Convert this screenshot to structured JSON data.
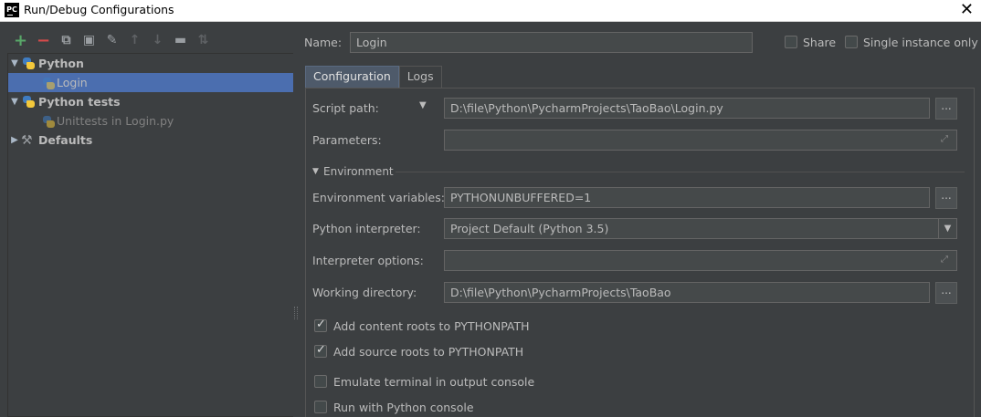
{
  "window": {
    "title": "Run/Debug Configurations",
    "app_icon_text": "PC",
    "close_glyph": "✕"
  },
  "toolbar": {
    "add": "+",
    "remove": "−",
    "copy": "⧉",
    "save": "▣",
    "edit": "✎",
    "move_up": "↑",
    "move_down": "↓",
    "folder": "▬",
    "sort": "⇅"
  },
  "tree": {
    "items": [
      {
        "label": "Python",
        "expanded": true,
        "glyph": "▼"
      },
      {
        "label": "Login",
        "selected": true
      },
      {
        "label": "Python tests",
        "expanded": true,
        "glyph": "▼"
      },
      {
        "label": "Unittests in Login.py"
      },
      {
        "label": "Defaults",
        "expanded": false,
        "glyph": "▶"
      }
    ]
  },
  "name_row": {
    "label": "Name:",
    "value": "Login",
    "share_label": "Share",
    "share_checked": false,
    "single_instance_label": "Single instance only",
    "single_instance_checked": false
  },
  "tabs": [
    {
      "label": "Configuration",
      "active": true
    },
    {
      "label": "Logs",
      "active": false
    }
  ],
  "config": {
    "script_path_label": "Script path:",
    "script_path_dropdown": "▼",
    "script_path_value": "D:\\file\\Python\\PycharmProjects\\TaoBao\\Login.py",
    "parameters_label": "Parameters:",
    "parameters_value": "",
    "environment_section": "Environment",
    "environment_glyph": "▼",
    "env_vars_label": "Environment variables:",
    "env_vars_value": "PYTHONUNBUFFERED=1",
    "interpreter_label": "Python interpreter:",
    "interpreter_value": "Project Default (Python 3.5)",
    "interpreter_options_label": "Interpreter options:",
    "interpreter_options_value": "",
    "working_dir_label": "Working directory:",
    "working_dir_value": "D:\\file\\Python\\PycharmProjects\\TaoBao",
    "browse_glyph": "...",
    "expand_glyph": "⤢",
    "dropdown_glyph": "▼",
    "checkboxes": [
      {
        "label": "Add content roots to PYTHONPATH",
        "checked": true
      },
      {
        "label": "Add source roots to PYTHONPATH",
        "checked": true
      },
      {
        "label": "Emulate terminal in output console",
        "checked": false
      },
      {
        "label": "Run with Python console",
        "checked": false
      }
    ]
  },
  "colors": {
    "background": "#3c3f41",
    "selection": "#4b6eaf",
    "field_bg": "#45494a",
    "text": "#bbbbbb",
    "add_green": "#59a869",
    "remove_red": "#d74b4b"
  }
}
